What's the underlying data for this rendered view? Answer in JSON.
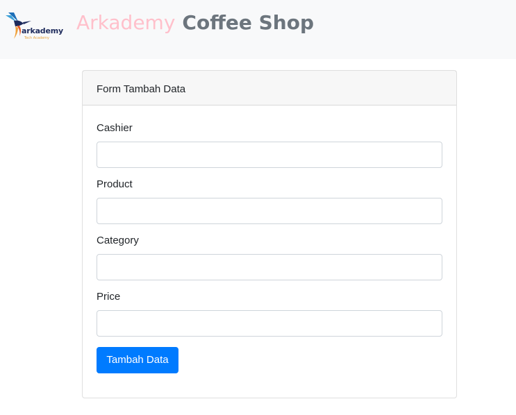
{
  "navbar": {
    "logo_text": "arkademy",
    "logo_subtext": "Tech Academy",
    "brand_primary": "Arkademy",
    "brand_secondary": "Coffee Shop",
    "brand_primary_color": "#ffc0cb",
    "brand_secondary_color": "#6c757d"
  },
  "form": {
    "title": "Form Tambah Data",
    "fields": [
      {
        "label": "Cashier",
        "value": ""
      },
      {
        "label": "Product",
        "value": ""
      },
      {
        "label": "Category",
        "value": ""
      },
      {
        "label": "Price",
        "value": ""
      }
    ],
    "submit_label": "Tambah Data",
    "submit_color": "#007bff"
  }
}
